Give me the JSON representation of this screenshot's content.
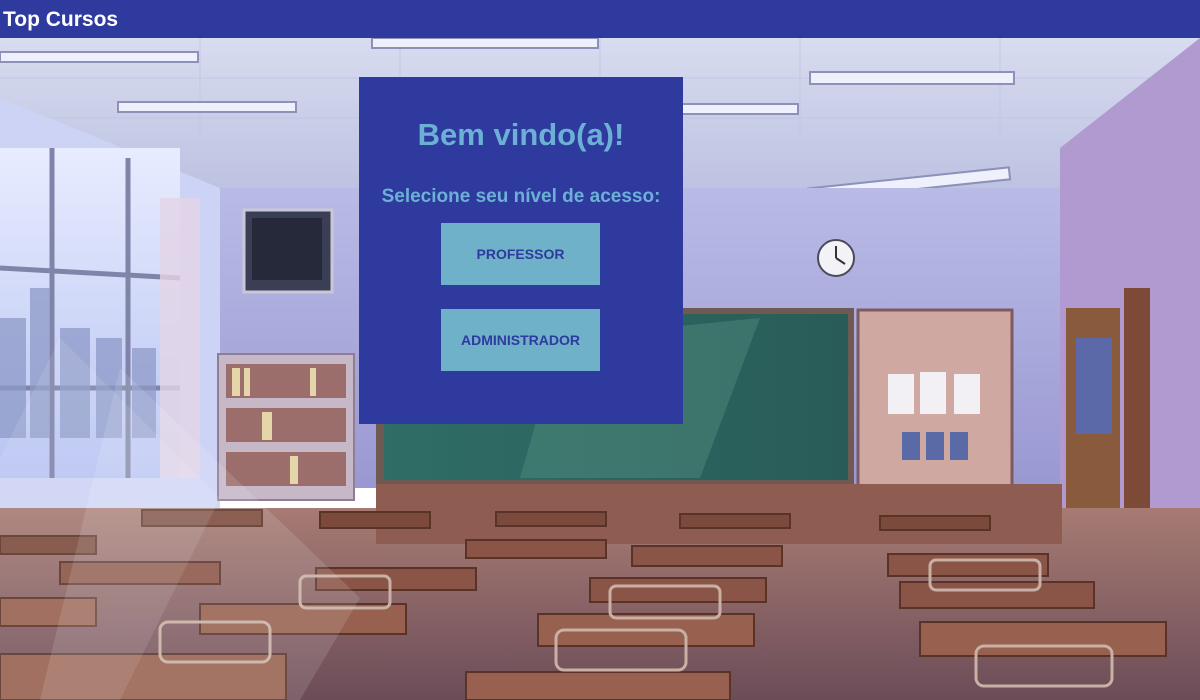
{
  "app": {
    "title": "Top Cursos"
  },
  "login": {
    "welcome": "Bem vindo(a)!",
    "prompt": "Selecione seu nível de acesso:",
    "professor_label": "PROFESSOR",
    "admin_label": "ADMINISTRADOR"
  },
  "background": {
    "scene": "anime-classroom"
  },
  "colors": {
    "header_bg": "#2e3a9e",
    "panel_bg": "#2e3a9e",
    "heading_text": "#6cb0d6",
    "button_bg": "#6fb1c9",
    "button_text": "#2e3a9e"
  }
}
